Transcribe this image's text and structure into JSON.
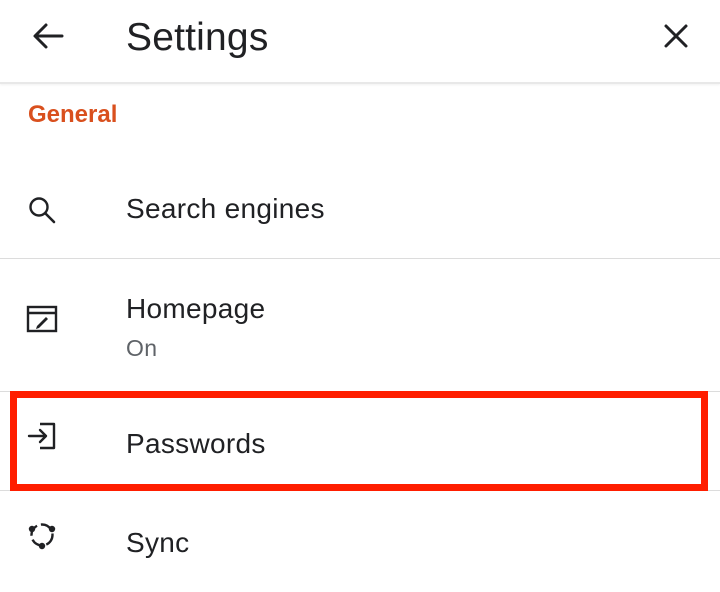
{
  "appbar": {
    "title": "Settings",
    "back_icon": "arrow-left-icon",
    "close_icon": "close-icon"
  },
  "section": {
    "header": "General",
    "header_color": "#d9501e"
  },
  "items": [
    {
      "label": "Search engines",
      "sublabel": "",
      "icon": "search-icon"
    },
    {
      "label": "Homepage",
      "sublabel": "On",
      "icon": "homepage-icon"
    },
    {
      "label": "Passwords",
      "sublabel": "",
      "icon": "sign-in-icon"
    },
    {
      "label": "Sync",
      "sublabel": "",
      "icon": "sync-icon"
    }
  ],
  "highlight_color": "#ff1e00"
}
